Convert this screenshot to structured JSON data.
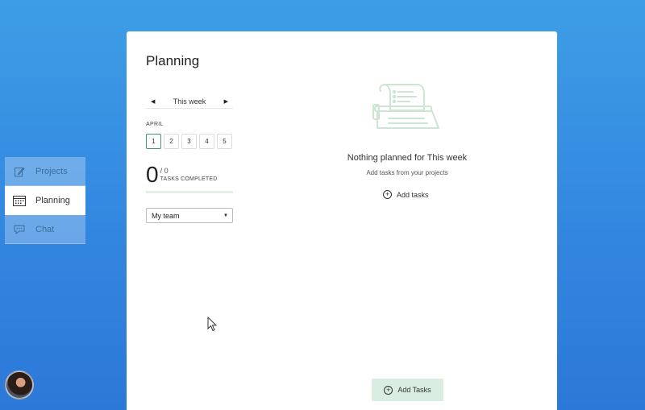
{
  "sidebar": {
    "items": [
      {
        "label": "Projects",
        "icon": "edit-icon"
      },
      {
        "label": "Planning",
        "icon": "calendar-icon"
      },
      {
        "label": "Chat",
        "icon": "chat-bubble-icon"
      }
    ],
    "active": "Planning"
  },
  "planning": {
    "title": "Planning",
    "week_label": "This week",
    "month": "APRIL",
    "days": [
      "1",
      "2",
      "3",
      "4",
      "5"
    ],
    "selected_day": "1",
    "completed_count": "0",
    "total": "/ 0",
    "completed_label": "TASKS COMPLETED",
    "progress_fraction": 0,
    "team_select": "My team"
  },
  "empty_state": {
    "title": "Nothing planned for This week",
    "subtitle": "Add tasks from your projects",
    "add_link": "Add tasks"
  },
  "footer": {
    "add_button": "Add Tasks"
  },
  "colors": {
    "accent": "#3f9a6e",
    "button_bg": "#d9eee0",
    "background": "#3387e0"
  }
}
